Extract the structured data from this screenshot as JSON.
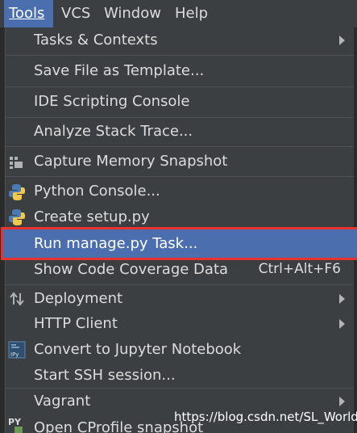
{
  "menubar": {
    "items": [
      {
        "label": "Tools"
      },
      {
        "label": "VCS"
      },
      {
        "label": "Window"
      },
      {
        "label": "Help"
      }
    ]
  },
  "menu": {
    "items": [
      {
        "label": "Tasks & Contexts",
        "submenu": true
      },
      {
        "label": "Save File as Template..."
      },
      {
        "label": "IDE Scripting Console"
      },
      {
        "label": "Analyze Stack Trace..."
      },
      {
        "label": "Capture Memory Snapshot",
        "icon": "memory-snapshot-icon"
      },
      {
        "label": "Python Console...",
        "icon": "python-icon"
      },
      {
        "label": "Create setup.py",
        "icon": "python-icon"
      },
      {
        "label": "Run manage.py Task...",
        "selected": true
      },
      {
        "label": "Show Code Coverage Data",
        "shortcut": "Ctrl+Alt+F6"
      },
      {
        "label": "Deployment",
        "submenu": true,
        "icon": "deployment-arrows-icon"
      },
      {
        "label": "HTTP Client",
        "submenu": true
      },
      {
        "label": "Convert to Jupyter Notebook",
        "icon": "jupyter-icon"
      },
      {
        "label": "Start SSH session..."
      },
      {
        "label": "Vagrant",
        "submenu": true
      },
      {
        "label": "Open CProfile snapshot",
        "icon": "python-profile-icon"
      }
    ]
  },
  "watermark": "https://blog.csdn.net/SL_World",
  "colors": {
    "menu_bg": "#3c3f41",
    "selection": "#4b6eaf",
    "highlight_border": "#e8332f",
    "text": "#dcdcdc"
  }
}
